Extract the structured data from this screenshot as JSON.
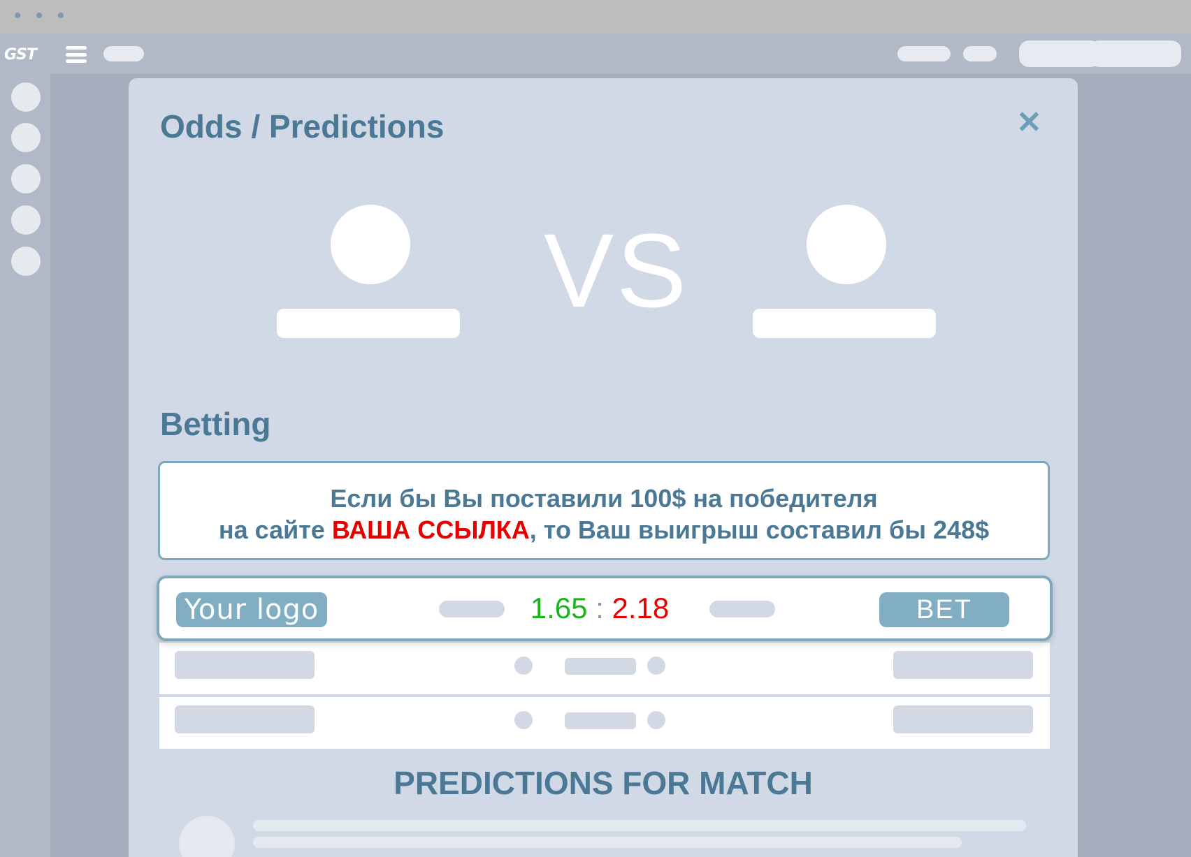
{
  "window": {
    "dots": "• • •"
  },
  "topbar": {
    "logo_text": "GST",
    "menu_icon": "hamburger-icon"
  },
  "modal": {
    "title": "Odds / Predictions",
    "close_icon": "close-icon",
    "close_glyph": "✕",
    "vs_text": "VS",
    "betting_title": "Betting",
    "info": {
      "line1": "Если бы Вы поставили 100$ на победителя",
      "line2_before": "на сайте ",
      "line2_link": "ВАША ССЫЛКА",
      "line2_after": ", то Ваш выигрыш составил бы 248$"
    },
    "odds_row": {
      "logo_label": "Your logo",
      "odds_home": "1.65",
      "odds_separator": ":",
      "odds_away": "2.18",
      "bet_label": "BET"
    },
    "predictions_title": "PREDICTIONS FOR MATCH"
  },
  "colors": {
    "accent": "#4b7894",
    "button": "#81aec2",
    "odds_home": "#1ab51a",
    "odds_away": "#e60000",
    "link": "#e60000"
  }
}
